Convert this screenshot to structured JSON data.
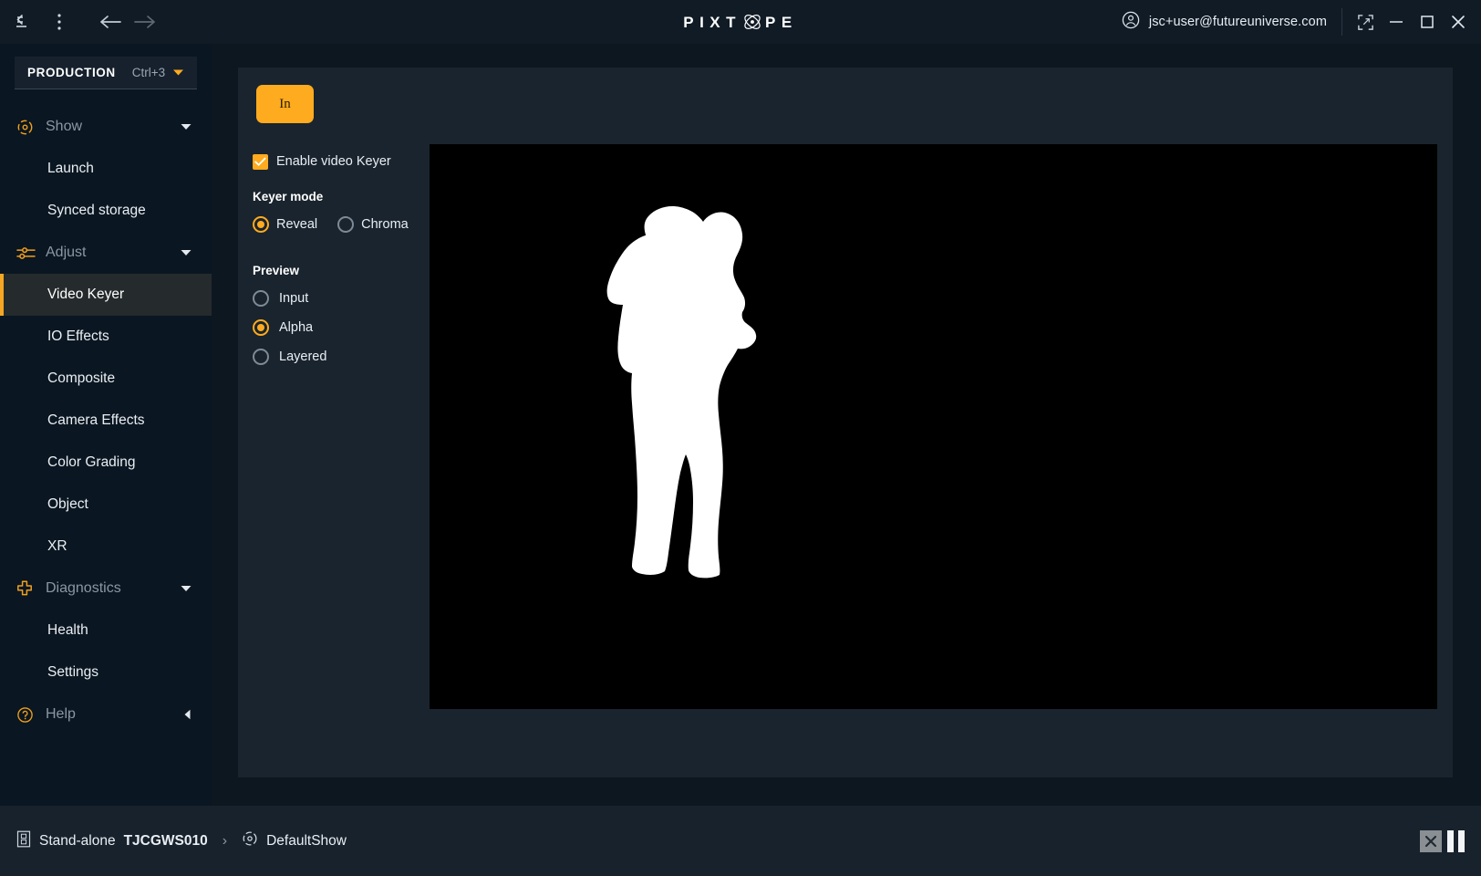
{
  "app": {
    "logo_left": "PIX",
    "logo_mid": "T",
    "logo_right": "PE",
    "accent": "#ffab1f",
    "panel_bg": "#1a242e",
    "sidebar_bg": "#0a1621"
  },
  "topbar": {
    "collapse_icon": "collapse-sidebar-icon",
    "menu_icon": "more-vertical-icon",
    "back_icon": "arrow-back-icon",
    "forward_icon": "arrow-forward-icon",
    "user_icon": "user-account-icon",
    "user_email": "jsc+user@futureuniverse.com",
    "screenshot_icon": "capture-icon",
    "minimize_icon": "minimize-icon",
    "maximize_icon": "maximize-icon",
    "close_icon": "close-icon"
  },
  "sidebar": {
    "production": {
      "label": "PRODUCTION",
      "shortcut": "Ctrl+3",
      "caret_icon": "chevron-down-icon"
    },
    "groups": [
      {
        "label": "Show",
        "icon": "show-icon",
        "caret": "chevron-down-icon",
        "expanded": true,
        "items": [
          {
            "label": "Launch",
            "active": false
          },
          {
            "label": "Synced storage",
            "active": false
          }
        ]
      },
      {
        "label": "Adjust",
        "icon": "sliders-icon",
        "caret": "chevron-down-icon",
        "expanded": true,
        "items": [
          {
            "label": "Video Keyer",
            "active": true
          },
          {
            "label": "IO Effects",
            "active": false
          },
          {
            "label": "Composite",
            "active": false
          },
          {
            "label": "Camera Effects",
            "active": false
          },
          {
            "label": "Color Grading",
            "active": false
          },
          {
            "label": "Object",
            "active": false
          },
          {
            "label": "XR",
            "active": false
          }
        ]
      },
      {
        "label": "Diagnostics",
        "icon": "medical-cross-icon",
        "caret": "chevron-down-icon",
        "expanded": true,
        "items": [
          {
            "label": "Health",
            "active": false
          },
          {
            "label": "Settings",
            "active": false
          }
        ]
      },
      {
        "label": "Help",
        "icon": "help-circle-icon",
        "caret": "chevron-left-icon",
        "expanded": false,
        "items": []
      }
    ]
  },
  "main": {
    "in_button": "In",
    "enable_keyer": {
      "label": "Enable video Keyer",
      "checked": true
    },
    "keyer_mode": {
      "title": "Keyer mode",
      "options": [
        {
          "label": "Reveal",
          "selected": true
        },
        {
          "label": "Chroma",
          "selected": false
        }
      ]
    },
    "preview": {
      "title": "Preview",
      "options": [
        {
          "label": "Input",
          "selected": false
        },
        {
          "label": "Alpha",
          "selected": true
        },
        {
          "label": "Layered",
          "selected": false
        }
      ]
    },
    "viewport": {
      "name": "alpha-matte-preview",
      "background": "#000000",
      "subject": "person-silhouette"
    }
  },
  "statusbar": {
    "mode_icon": "server-icon",
    "mode": "Stand-alone",
    "machine": "TJCGWS010",
    "separator": "›",
    "show_icon": "show-icon",
    "show_name": "DefaultShow",
    "stop_icon": "stop-icon",
    "pause_icon": "pause-icon"
  }
}
